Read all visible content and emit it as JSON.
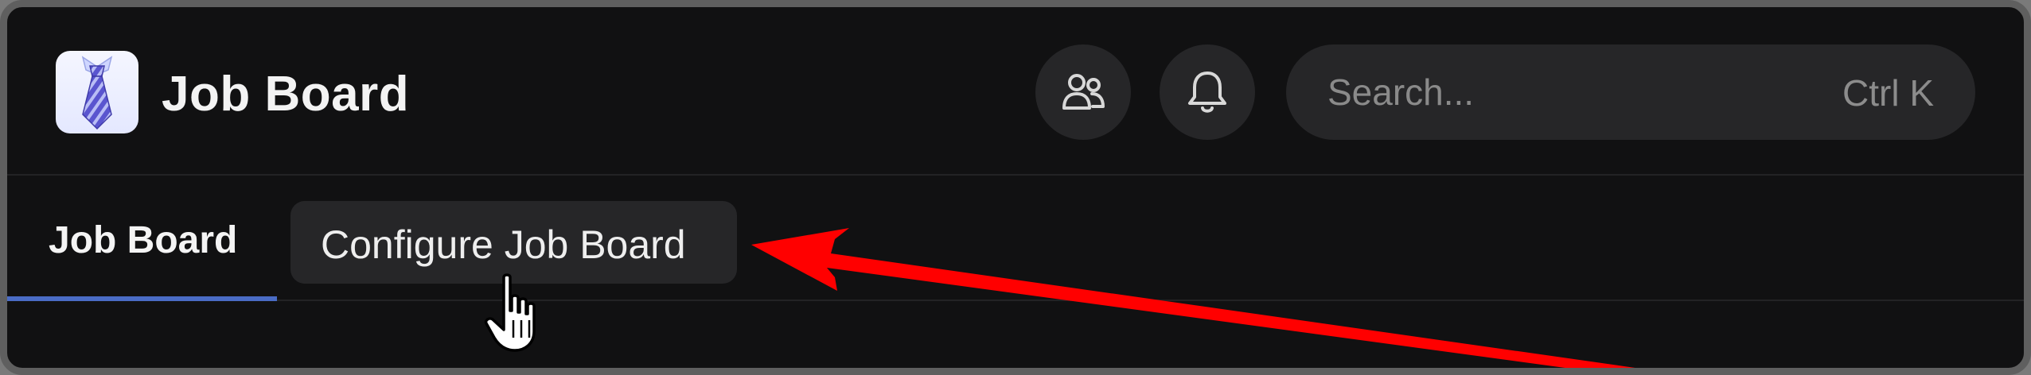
{
  "header": {
    "app_title": "Job Board",
    "logo_icon": "necktie-icon",
    "people_icon": "people-icon",
    "bell_icon": "bell-icon"
  },
  "search": {
    "placeholder": "Search...",
    "shortcut": "Ctrl K"
  },
  "tabs": [
    {
      "label": "Job Board",
      "active": true
    },
    {
      "label": "Configure Job Board",
      "active": false
    }
  ],
  "colors": {
    "background": "#111112",
    "surface": "#262628",
    "accent": "#4a6cc5",
    "annotation_arrow": "#ff0000"
  }
}
